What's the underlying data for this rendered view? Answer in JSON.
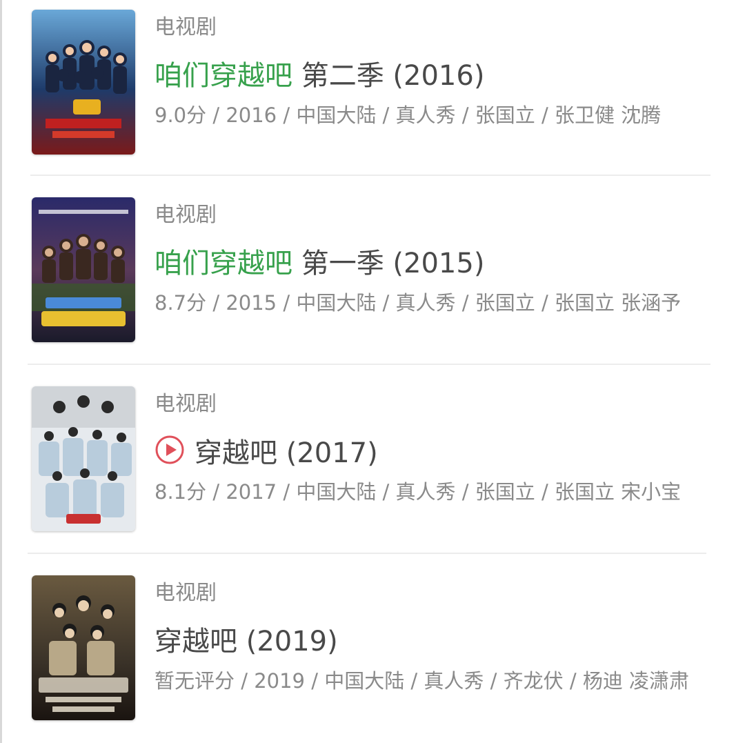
{
  "results": [
    {
      "category": "电视剧",
      "title_highlight": "咱们穿越吧",
      "title_rest": " 第二季 (2016)",
      "meta": "9.0分 / 2016 / 中国大陆 / 真人秀 / 张国立 / 张卫健 沈腾",
      "poster_name": "show-poster-season-2"
    },
    {
      "category": "电视剧",
      "title_highlight": "咱们穿越吧",
      "title_rest": " 第一季 (2015)",
      "meta": "8.7分 / 2015 / 中国大陆 / 真人秀 / 张国立 / 张国立 张涵予",
      "poster_name": "show-poster-season-1"
    },
    {
      "category": "电视剧",
      "play_icon": "play-circle-icon",
      "title_rest": "穿越吧 (2017)",
      "meta": "8.1分 / 2017 / 中国大陆 / 真人秀 / 张国立 / 张国立 宋小宝",
      "poster_name": "show-poster-2017"
    },
    {
      "category": "电视剧",
      "title_rest": "穿越吧 (2019)",
      "meta": "暂无评分 / 2019 / 中国大陆 / 真人秀 / 齐龙伏 / 杨迪 凌潇肃",
      "poster_name": "show-poster-2019"
    }
  ],
  "colors": {
    "highlight": "#37a14c",
    "title": "#494949",
    "secondary": "#8a8a8a",
    "play_icon": "#e0505a",
    "divider": "#ececec"
  }
}
